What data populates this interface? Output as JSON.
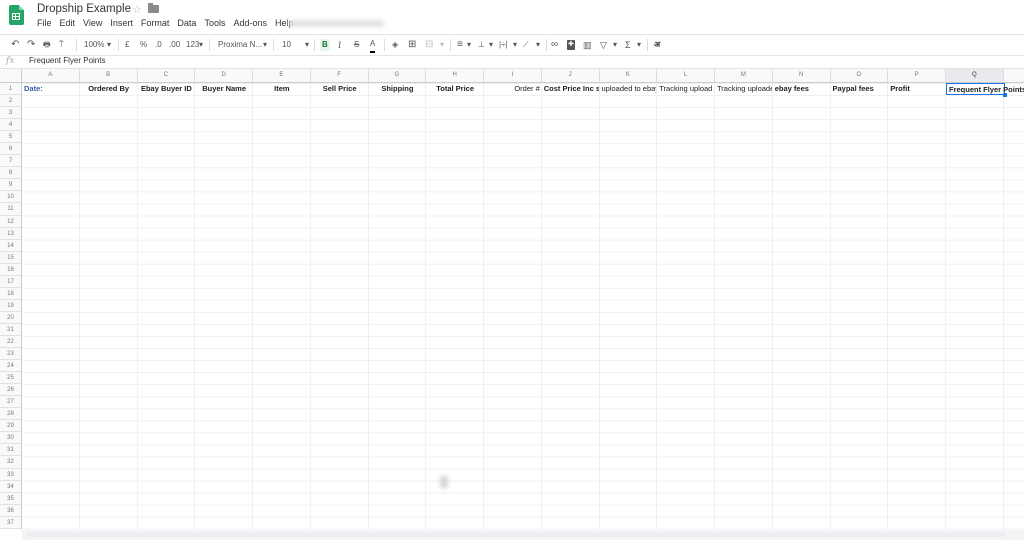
{
  "app": {
    "doc_title": "Dropship Example",
    "menu": [
      "File",
      "Edit",
      "View",
      "Insert",
      "Format",
      "Data",
      "Tools",
      "Add-ons",
      "Help"
    ]
  },
  "toolbar": {
    "undo": "↶",
    "redo": "↷",
    "print": "🖶",
    "paint_format": "⍑",
    "zoom": "100%",
    "currency": "£",
    "percent": "%",
    "decrease_decimal": ".0",
    "increase_decimal": ".00",
    "more_formats": "123",
    "font": "Proxima N...",
    "font_size": "10",
    "bold": "B",
    "italic": "I",
    "strikethrough": "S",
    "text_color": "A",
    "fill_color": "◈",
    "borders": "⊞",
    "merge": "⊟",
    "align_h": "≡",
    "align_v": "⊥",
    "wrap": "|÷|",
    "rotate": "⟋",
    "link": "∞",
    "comment": "✚",
    "chart": "▥",
    "filter": "▽",
    "functions": "Σ",
    "input_tools": "अ",
    "dropdown": "▾"
  },
  "formula_bar": {
    "fx": "fx",
    "value": "Frequent Flyer Points"
  },
  "columns": [
    "A",
    "B",
    "C",
    "D",
    "E",
    "F",
    "G",
    "H",
    "I",
    "J",
    "K",
    "L",
    "M",
    "N",
    "O",
    "P",
    "Q"
  ],
  "selected_column": "Q",
  "rows": [
    "1",
    "2",
    "3",
    "4",
    "5",
    "6",
    "7",
    "8",
    "9",
    "10",
    "11",
    "12",
    "13",
    "14",
    "15",
    "16",
    "17",
    "18",
    "19",
    "20",
    "21",
    "22",
    "23",
    "24",
    "25",
    "26",
    "27",
    "28",
    "29",
    "30",
    "31",
    "32",
    "33",
    "34",
    "35",
    "36",
    "37"
  ],
  "row1": {
    "A": "Date:",
    "B": "Ordered By",
    "C": "Ebay Buyer ID",
    "D": "Buyer Name",
    "E": "Item",
    "F": "Sell Price",
    "G": "Shipping",
    "H": "Total Price",
    "I": "Order #",
    "J": "Cost Price Inc shipping",
    "K": "uploaded to ebay",
    "L": "Tracking upload ebay",
    "M": "Tracking uploaded",
    "N": "ebay fees",
    "O": "Paypal fees",
    "P": "Profit",
    "Q": "Frequent Flyer Points"
  },
  "colors": {
    "brand_green": "#23a566",
    "selection_blue": "#1a73e8",
    "date_text": "#3c5ea8"
  }
}
